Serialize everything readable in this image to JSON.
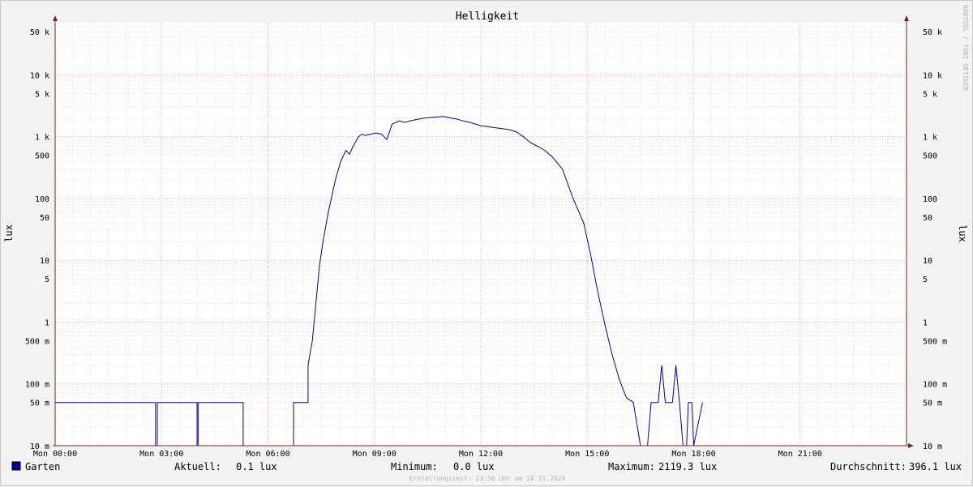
{
  "chart_data": {
    "type": "line",
    "title": "Helligkeit",
    "ylabel": "lux",
    "y_scale": "log",
    "ylim": [
      0.01,
      70000
    ],
    "y_ticks": [
      {
        "value": 0.01,
        "label": "10 m",
        "major": true
      },
      {
        "value": 0.05,
        "label": "50 m",
        "major": false
      },
      {
        "value": 0.1,
        "label": "100 m",
        "major": true
      },
      {
        "value": 0.5,
        "label": "500 m",
        "major": false
      },
      {
        "value": 1,
        "label": "1",
        "major": true
      },
      {
        "value": 5,
        "label": "5",
        "major": false
      },
      {
        "value": 10,
        "label": "10",
        "major": true
      },
      {
        "value": 50,
        "label": "50",
        "major": false
      },
      {
        "value": 100,
        "label": "100",
        "major": true
      },
      {
        "value": 500,
        "label": "500",
        "major": false
      },
      {
        "value": 1000,
        "label": "1 k",
        "major": true
      },
      {
        "value": 5000,
        "label": "5 k",
        "major": false
      },
      {
        "value": 10000,
        "label": "10 k",
        "major": true
      },
      {
        "value": 50000,
        "label": "50 k",
        "major": false
      }
    ],
    "xlim_hours": [
      0,
      24
    ],
    "x_ticks": [
      {
        "hour": 0,
        "label": "Mon 00:00"
      },
      {
        "hour": 3,
        "label": "Mon 03:00"
      },
      {
        "hour": 6,
        "label": "Mon 06:00"
      },
      {
        "hour": 9,
        "label": "Mon 09:00"
      },
      {
        "hour": 12,
        "label": "Mon 12:00"
      },
      {
        "hour": 15,
        "label": "Mon 15:00"
      },
      {
        "hour": 18,
        "label": "Mon 18:00"
      },
      {
        "hour": 21,
        "label": "Mon 21:00"
      }
    ],
    "grid": true,
    "series": [
      {
        "name": "Garten",
        "color": "#0000a0",
        "x_hours": [
          0,
          2.83,
          2.83,
          2.88,
          2.88,
          4.0,
          4.0,
          4.03,
          4.03,
          4.13,
          4.13,
          5.3,
          5.3,
          6.72,
          6.72,
          7.13,
          7.13,
          7.25,
          7.35,
          7.45,
          7.55,
          7.7,
          7.8,
          7.9,
          8.05,
          8.2,
          8.3,
          8.4,
          8.55,
          8.65,
          8.75,
          8.9,
          9.05,
          9.2,
          9.35,
          9.5,
          9.7,
          9.85,
          10.0,
          10.2,
          10.4,
          10.6,
          10.8,
          10.95,
          11.1,
          11.15,
          11.3,
          11.5,
          11.7,
          11.85,
          12.0,
          12.2,
          12.4,
          12.6,
          12.8,
          13.0,
          13.2,
          13.4,
          13.6,
          13.8,
          14.0,
          14.3,
          14.6,
          14.9,
          15.1,
          15.3,
          15.5,
          15.7,
          15.9,
          16.1,
          16.3,
          16.5,
          16.7,
          16.8,
          16.9,
          17.0,
          17.1,
          17.2,
          17.3,
          17.4,
          17.5,
          17.6,
          17.7,
          17.8,
          17.85,
          17.95,
          18.0,
          18.0,
          18.25,
          18.25,
          19.23,
          19.23,
          19.3,
          19.3,
          21.8,
          21.8,
          21.93,
          21.93,
          22.3,
          22.3,
          22.7,
          22.7,
          23.9,
          23.9,
          24.0
        ],
        "y_values": [
          0.05,
          0.05,
          0.01,
          0.01,
          0.05,
          0.05,
          0.01,
          0.01,
          0.05,
          0.05,
          0.05,
          0.05,
          0.01,
          0.01,
          0.05,
          0.05,
          0.2,
          0.5,
          2,
          8,
          20,
          60,
          110,
          200,
          400,
          600,
          520,
          700,
          1000,
          1100,
          1050,
          1100,
          1150,
          1100,
          900,
          1600,
          1800,
          1700,
          1800,
          1900,
          2000,
          2050,
          2100,
          2119.3,
          2050,
          2000,
          1950,
          1800,
          1700,
          1600,
          1500,
          1450,
          1400,
          1350,
          1300,
          1200,
          1000,
          800,
          700,
          600,
          480,
          300,
          100,
          40,
          12,
          3,
          0.9,
          0.3,
          0.12,
          0.06,
          0.05,
          0.01,
          0.01,
          0.05,
          0.05,
          0.05,
          0.2,
          0.05,
          0.05,
          0.05,
          0.2,
          0.05,
          0.01,
          0.01,
          0.05,
          0.05,
          0.01,
          0.01,
          0.05,
          0.05
        ]
      }
    ]
  },
  "watermark": "RRDTOOL / TOBI OETIKER",
  "legend": {
    "series_name": "Garten",
    "color": "#0000a0",
    "current_label": "Aktuell:",
    "current_value": "0.1 lux",
    "min_label": "Minimum:",
    "min_value": "0.0 lux",
    "max_label": "Maximum:",
    "max_value": "2119.3 lux",
    "avg_label": "Durchschnitt:",
    "avg_value": "396.1 lux"
  },
  "footer": "Erstellungszeit: 23:58 Uhr am 18.11.2024",
  "colors": {
    "major_grid": "#ff8080",
    "minor_grid": "#d0d0d0",
    "axis": "#6e2b1e",
    "plot_bg": "#ffffff"
  }
}
